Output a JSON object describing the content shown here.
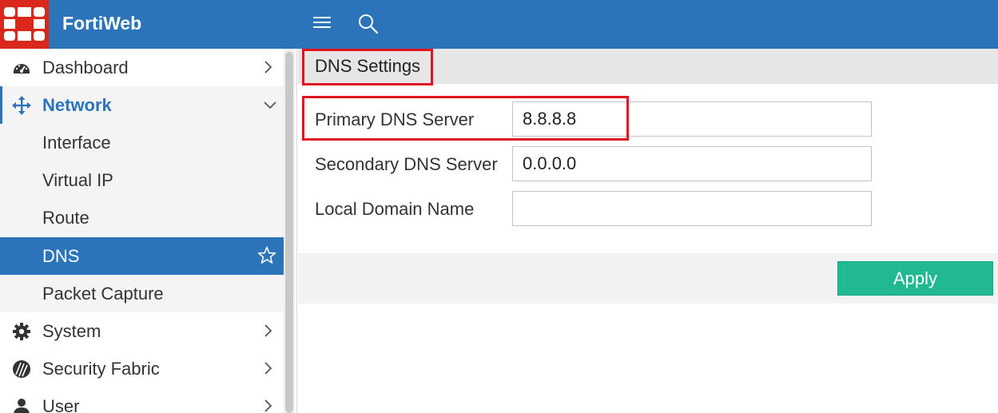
{
  "app": {
    "brand": "FortiWeb"
  },
  "header": {
    "menu_icon": "hamburger-menu-icon",
    "search_icon": "search-icon"
  },
  "sidebar": {
    "items": [
      {
        "label": "Dashboard",
        "icon": "dashboard-icon"
      },
      {
        "label": "Network",
        "icon": "network-icon",
        "expanded": true
      },
      {
        "label": "Interface"
      },
      {
        "label": "Virtual IP"
      },
      {
        "label": "Route"
      },
      {
        "label": "DNS",
        "selected": true
      },
      {
        "label": "Packet Capture"
      },
      {
        "label": "System",
        "icon": "gear-icon"
      },
      {
        "label": "Security Fabric",
        "icon": "security-fabric-icon"
      },
      {
        "label": "User",
        "icon": "user-icon"
      }
    ]
  },
  "dns": {
    "title": "DNS Settings",
    "fields": [
      {
        "label": "Primary DNS Server",
        "value": "8.8.8.8"
      },
      {
        "label": "Secondary DNS Server",
        "value": "0.0.0.0"
      },
      {
        "label": "Local Domain Name",
        "value": ""
      }
    ],
    "apply_label": "Apply"
  },
  "colors": {
    "header_bg": "#2b74b9",
    "logo_bg": "#da291c",
    "selected_bg": "#2b74b9",
    "apply_bg": "#21b993",
    "highlight": "#e0141e"
  }
}
